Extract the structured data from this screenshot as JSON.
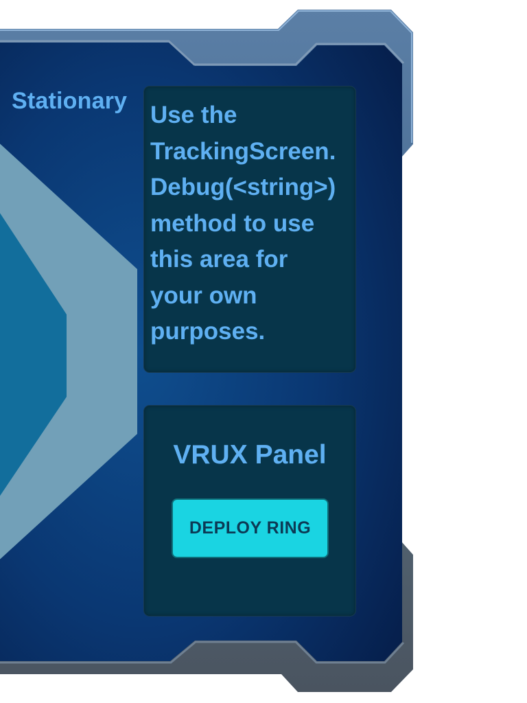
{
  "status": {
    "label": "Stationary"
  },
  "debug_panel": {
    "text": "Use the\nTrackingScreen.\nDebug(<string>)\nmethod to use\nthis area for\nyour own\npurposes."
  },
  "vrux_panel": {
    "title": "VRUX Panel",
    "deploy_button_label": "DEPLOY RING"
  },
  "colors": {
    "text_accent": "#5fb0f2",
    "panel_background": "#07354a",
    "screen_background": "#0a2f66",
    "frame_metal": "#4a6e95",
    "button_fill": "#1ad4e2",
    "button_text": "#0c3a55",
    "hexagon_outer": "#72a0b8",
    "hexagon_inner": "#126e9c"
  }
}
